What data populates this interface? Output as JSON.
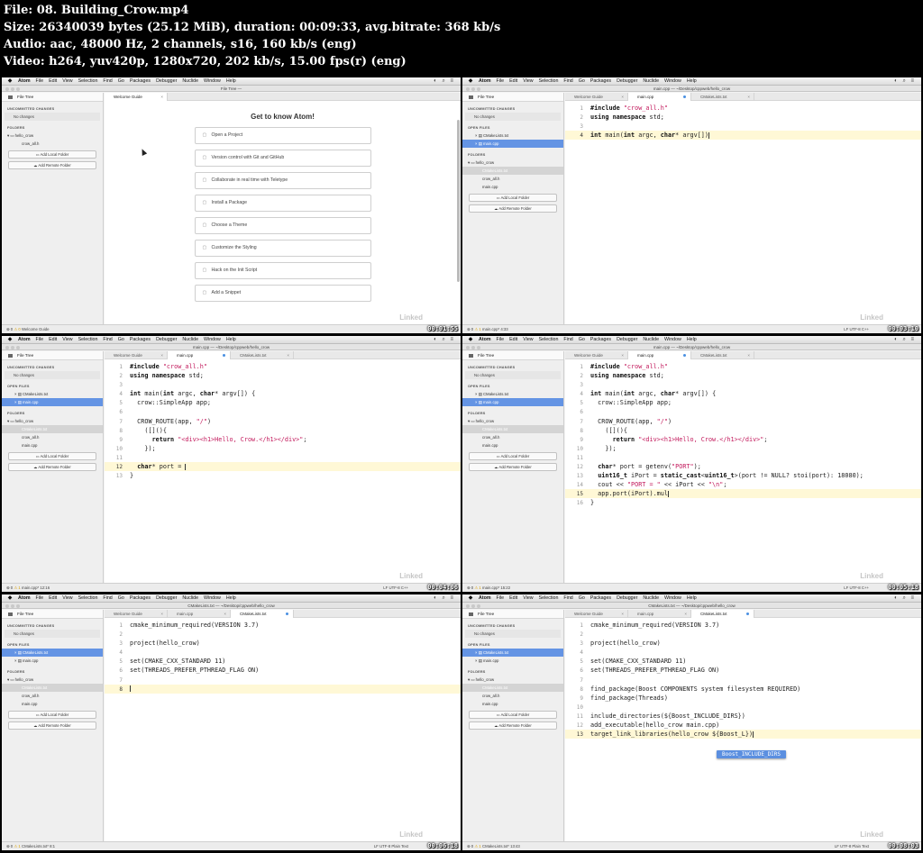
{
  "header": {
    "file": "File: 08. Building_Crow.mp4",
    "size": "Size: 26340039 bytes (25.12 MiB), duration: 00:09:33, avg.bitrate: 368 kb/s",
    "audio": "Audio: aac, 48000 Hz, 2 channels, s16, 160 kb/s (eng)",
    "video": "Video: h264, yuv420p, 1280x720, 202 kb/s, 15.00 fps(r) (eng)"
  },
  "menu": [
    "File",
    "Edit",
    "View",
    "Selection",
    "Find",
    "Go",
    "Packages",
    "Debugger",
    "Nuclide",
    "Window",
    "Help"
  ],
  "app_name": "Atom",
  "sidebar_labels": {
    "file_tree": "File Tree",
    "uncommitted": "UNCOMMITTED CHANGES",
    "no_changes": "No changes",
    "open_files": "OPEN FILES",
    "folders": "FOLDERS",
    "add_local": "Add Local Folder",
    "add_remote": "Add Remote Folder"
  },
  "thumbs": [
    {
      "title": "File Tree —",
      "timestamp": "00:01:55",
      "welcome": {
        "title": "Get to know Atom!",
        "items": [
          "Open a Project",
          "Version control with Git and GitHub",
          "Collaborate in real time with Teletype",
          "Install a Package",
          "Choose a Theme",
          "Customize the Styling",
          "Hack on the Init Script",
          "Add a Snippet"
        ]
      },
      "tabs": [
        {
          "label": "Welcome Guide",
          "active": true,
          "mark": "x"
        }
      ],
      "open_files": [],
      "folders": [
        {
          "label": "hello_crow",
          "level": 0
        },
        {
          "label": "crow_all.h",
          "level": 1
        }
      ],
      "status_left": "0  0  Welcome Guide",
      "status_right": ""
    },
    {
      "title": "main.cpp — ~/Desktop/cppweb/hello_crow",
      "timestamp": "00:03:10",
      "tabs": [
        {
          "label": "Welcome Guide",
          "active": false,
          "mark": "x"
        },
        {
          "label": "main.cpp",
          "active": true,
          "mark": "dot"
        },
        {
          "label": "CMakeLists.txt",
          "active": false,
          "mark": "x"
        }
      ],
      "open_files": [
        {
          "label": "CMakeLists.txt",
          "sel": false
        },
        {
          "label": "main.cpp",
          "sel": true
        }
      ],
      "folders": [
        {
          "label": "hello_crow",
          "level": 0
        },
        {
          "label": "CMakeLists.txt",
          "level": 1,
          "hl": true
        },
        {
          "label": "crow_all.h",
          "level": 1
        },
        {
          "label": "main.cpp",
          "level": 1
        }
      ],
      "code_start": 1,
      "code": [
        "#include \"crow_all.h\"",
        "using namespace std;",
        "",
        "int main(int argc, char* argv[])"
      ],
      "current_line": 4,
      "status_left": "0  1  main.cpp*  4:33",
      "status_right": "LF  UTF-8  C++"
    },
    {
      "title": "main.cpp — ~/Desktop/cppweb/hello_crow",
      "timestamp": "00:04:06",
      "tabs": [
        {
          "label": "Welcome Guide",
          "active": false,
          "mark": "x"
        },
        {
          "label": "main.cpp",
          "active": true,
          "mark": "dot"
        },
        {
          "label": "CMakeLists.txt",
          "active": false,
          "mark": "x"
        }
      ],
      "open_files": [
        {
          "label": "CMakeLists.txt",
          "sel": false
        },
        {
          "label": "main.cpp",
          "sel": true
        }
      ],
      "folders": [
        {
          "label": "hello_crow",
          "level": 0
        },
        {
          "label": "CMakeLists.txt",
          "level": 1,
          "hl": true
        },
        {
          "label": "crow_all.h",
          "level": 1
        },
        {
          "label": "main.cpp",
          "level": 1
        }
      ],
      "code_start": 1,
      "code": [
        "#include \"crow_all.h\"",
        "using namespace std;",
        "",
        "int main(int argc, char* argv[]) {",
        "  crow::SimpleApp app;",
        "",
        "  CROW_ROUTE(app, \"/\")",
        "    ([](){",
        "      return \"<div><h1>Hello, Crow.</h1></div>\";",
        "    });",
        "",
        "  char* port = ",
        "}"
      ],
      "current_line": 12,
      "status_left": "0  1  main.cpp*  12:16",
      "status_right": "LF  UTF-8  C++"
    },
    {
      "title": "main.cpp — ~/Desktop/cppweb/hello_crow",
      "timestamp": "00:05:18",
      "tabs": [
        {
          "label": "Welcome Guide",
          "active": false,
          "mark": "x"
        },
        {
          "label": "main.cpp",
          "active": true,
          "mark": "dot"
        },
        {
          "label": "CMakeLists.txt",
          "active": false,
          "mark": "x"
        }
      ],
      "open_files": [
        {
          "label": "CMakeLists.txt",
          "sel": false
        },
        {
          "label": "main.cpp",
          "sel": true
        }
      ],
      "folders": [
        {
          "label": "hello_crow",
          "level": 0
        },
        {
          "label": "CMakeLists.txt",
          "level": 1,
          "hl": true
        },
        {
          "label": "crow_all.h",
          "level": 1
        },
        {
          "label": "main.cpp",
          "level": 1
        }
      ],
      "code_start": 1,
      "code": [
        "#include \"crow_all.h\"",
        "using namespace std;",
        "",
        "int main(int argc, char* argv[]) {",
        "  crow::SimpleApp app;",
        "",
        "  CROW_ROUTE(app, \"/\")",
        "    ([](){",
        "      return \"<div><h1>Hello, Crow.</h1></div>\";",
        "    });",
        "",
        "  char* port = getenv(\"PORT\");",
        "  uint16_t iPort = static_cast<uint16_t>(port != NULL? stoi(port): 18080);",
        "  cout << \"PORT = \" << iPort << \"\\n\";",
        "  app.port(iPort).mul",
        "}"
      ],
      "current_line": 15,
      "status_left": "0  1  main.cpp*  15:22",
      "status_right": "LF  UTF-8  C++"
    },
    {
      "title": "CMakeLists.txt — ~/Desktop/cppweb/hello_crow",
      "timestamp": "00:06:18",
      "tabs": [
        {
          "label": "Welcome Guide",
          "active": false,
          "mark": "x"
        },
        {
          "label": "main.cpp",
          "active": false,
          "mark": "x"
        },
        {
          "label": "CMakeLists.txt",
          "active": true,
          "mark": "dot"
        }
      ],
      "open_files": [
        {
          "label": "CMakeLists.txt",
          "sel": true
        },
        {
          "label": "main.cpp",
          "sel": false
        }
      ],
      "folders": [
        {
          "label": "hello_crow",
          "level": 0
        },
        {
          "label": "CMakeLists.txt",
          "level": 1,
          "hl": true
        },
        {
          "label": "crow_all.h",
          "level": 1
        },
        {
          "label": "main.cpp",
          "level": 1
        }
      ],
      "code_start": 1,
      "code": [
        "cmake_minimum_required(VERSION 3.7)",
        "",
        "project(hello_crow)",
        "",
        "set(CMAKE_CXX_STANDARD 11)",
        "set(THREADS_PREFER_PTHREAD_FLAG ON)",
        "",
        ""
      ],
      "current_line": 8,
      "status_left": "0  1  CMakeLists.txt*  8:1",
      "status_right": "LF  UTF-8  Plain Text"
    },
    {
      "title": "CMakeLists.txt — ~/Desktop/cppweb/hello_crow",
      "timestamp": "00:08:03",
      "tabs": [
        {
          "label": "Welcome Guide",
          "active": false,
          "mark": "x"
        },
        {
          "label": "main.cpp",
          "active": false,
          "mark": "x"
        },
        {
          "label": "CMakeLists.txt",
          "active": true,
          "mark": "dot"
        }
      ],
      "open_files": [
        {
          "label": "CMakeLists.txt",
          "sel": true
        },
        {
          "label": "main.cpp",
          "sel": false
        }
      ],
      "folders": [
        {
          "label": "hello_crow",
          "level": 0
        },
        {
          "label": "CMakeLists.txt",
          "level": 1,
          "hl": true
        },
        {
          "label": "crow_all.h",
          "level": 1
        },
        {
          "label": "main.cpp",
          "level": 1
        }
      ],
      "code_start": 1,
      "code": [
        "cmake_minimum_required(VERSION 3.7)",
        "",
        "project(hello_crow)",
        "",
        "set(CMAKE_CXX_STANDARD 11)",
        "set(THREADS_PREFER_PTHREAD_FLAG ON)",
        "",
        "find_package(Boost COMPONENTS system filesystem REQUIRED)",
        "find_package(Threads)",
        "",
        "include_directories(${Boost_INCLUDE_DIRS})",
        "add_executable(hello_crow main.cpp)",
        "target_link_libraries(hello_crow ${Boost_L})"
      ],
      "current_line": 13,
      "autocomplete": "Boost_INCLUDE_DIRS",
      "status_left": "0  1  CMakeLists.txt*  13:43",
      "status_right": "LF  UTF-8  Plain Text"
    }
  ]
}
